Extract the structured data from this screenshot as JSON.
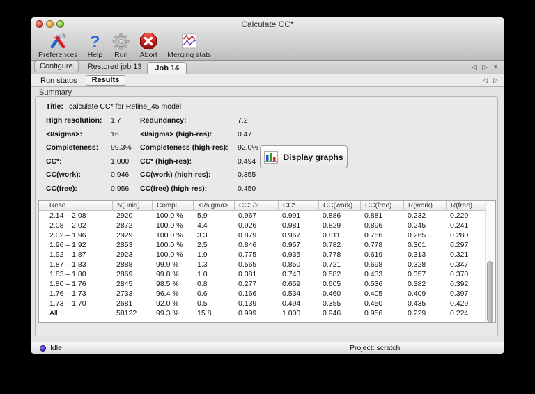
{
  "window": {
    "title": "Calculate CC*"
  },
  "icons": {
    "prev_glyph": "◁",
    "next_glyph": "▷",
    "close_glyph": "✕"
  },
  "toolbar": {
    "items": [
      {
        "name": "preferences-icon",
        "label": "Preferences"
      },
      {
        "name": "help-icon",
        "label": "Help"
      },
      {
        "name": "run-icon",
        "label": "Run"
      },
      {
        "name": "abort-icon",
        "label": "Abort"
      },
      {
        "name": "merging-stats-icon",
        "label": "Merging stats"
      }
    ]
  },
  "tabs": {
    "items": [
      {
        "label": "Configure"
      },
      {
        "label": "Restored job 13"
      },
      {
        "label": "Job 14",
        "active": true
      }
    ]
  },
  "subtabs": {
    "items": [
      {
        "label": "Run status"
      },
      {
        "label": "Results",
        "active": true
      }
    ]
  },
  "section": {
    "label": "Summary"
  },
  "summary": {
    "title_label": "Title:",
    "title_value": "calculate CC* for Refine_45 model",
    "rows": [
      {
        "k1": "High resolution:",
        "v1": "1.7",
        "k2": "Redundancy:",
        "v2": "7.2"
      },
      {
        "k1": "<I/sigma>:",
        "v1": "16",
        "k2": "<I/sigma> (high-res):",
        "v2": "0.47"
      },
      {
        "k1": "Completeness:",
        "v1": "99.3%",
        "k2": "Completeness (high-res):",
        "v2": "92.0%"
      },
      {
        "k1": "CC*:",
        "v1": "1.000",
        "k2": "CC* (high-res):",
        "v2": "0.494"
      },
      {
        "k1": "CC(work):",
        "v1": "0.946",
        "k2": "CC(work) (high-res):",
        "v2": "0.355"
      },
      {
        "k1": "CC(free):",
        "v1": "0.956",
        "k2": "CC(free) (high-res):",
        "v2": "0.450"
      }
    ],
    "display_graphs_label": "Display graphs"
  },
  "table": {
    "columns": [
      "Reso.",
      "N(uniq)",
      "Compl.",
      "<I/sigma>",
      "CC1/2",
      "CC*",
      "CC(work)",
      "CC(free)",
      "R(work)",
      "R(free)"
    ],
    "rows": [
      [
        "2.14 – 2.08",
        "2920",
        "100.0 %",
        "5.9",
        "0.967",
        "0.991",
        "0.886",
        "0.881",
        "0.232",
        "0.220"
      ],
      [
        "2.08 – 2.02",
        "2872",
        "100.0 %",
        "4.4",
        "0.926",
        "0.981",
        "0.829",
        "0.896",
        "0.245",
        "0.241"
      ],
      [
        "2.02 – 1.96",
        "2929",
        "100.0 %",
        "3.3",
        "0.879",
        "0.967",
        "0.811",
        "0.756",
        "0.265",
        "0.280"
      ],
      [
        "1.96 – 1.92",
        "2853",
        "100.0 %",
        "2.5",
        "0.846",
        "0.957",
        "0.782",
        "0.778",
        "0.301",
        "0.297"
      ],
      [
        "1.92 – 1.87",
        "2923",
        "100.0 %",
        "1.9",
        "0.775",
        "0.935",
        "0.778",
        "0.619",
        "0.313",
        "0.321"
      ],
      [
        "1.87 – 1.83",
        "2888",
        "99.9 %",
        "1.3",
        "0.565",
        "0.850",
        "0.721",
        "0.698",
        "0.328",
        "0.347"
      ],
      [
        "1.83 – 1.80",
        "2869",
        "99.8 %",
        "1.0",
        "0.381",
        "0.743",
        "0.582",
        "0.433",
        "0.357",
        "0.370"
      ],
      [
        "1.80 – 1.76",
        "2845",
        "98.5 %",
        "0.8",
        "0.277",
        "0.659",
        "0.605",
        "0.536",
        "0.382",
        "0.392"
      ],
      [
        "1.76 – 1.73",
        "2733",
        "96.4 %",
        "0.6",
        "0.166",
        "0.534",
        "0.460",
        "0.405",
        "0.409",
        "0.397"
      ],
      [
        "1.73 – 1.70",
        "2681",
        "92.0 %",
        "0.5",
        "0.139",
        "0.494",
        "0.355",
        "0.450",
        "0.435",
        "0.429"
      ],
      [
        "All",
        "58122",
        "99.3 %",
        "15.8",
        "0.999",
        "1.000",
        "0.946",
        "0.956",
        "0.229",
        "0.224"
      ]
    ]
  },
  "statusbar": {
    "status": "Idle",
    "project": "Project: scratch"
  }
}
